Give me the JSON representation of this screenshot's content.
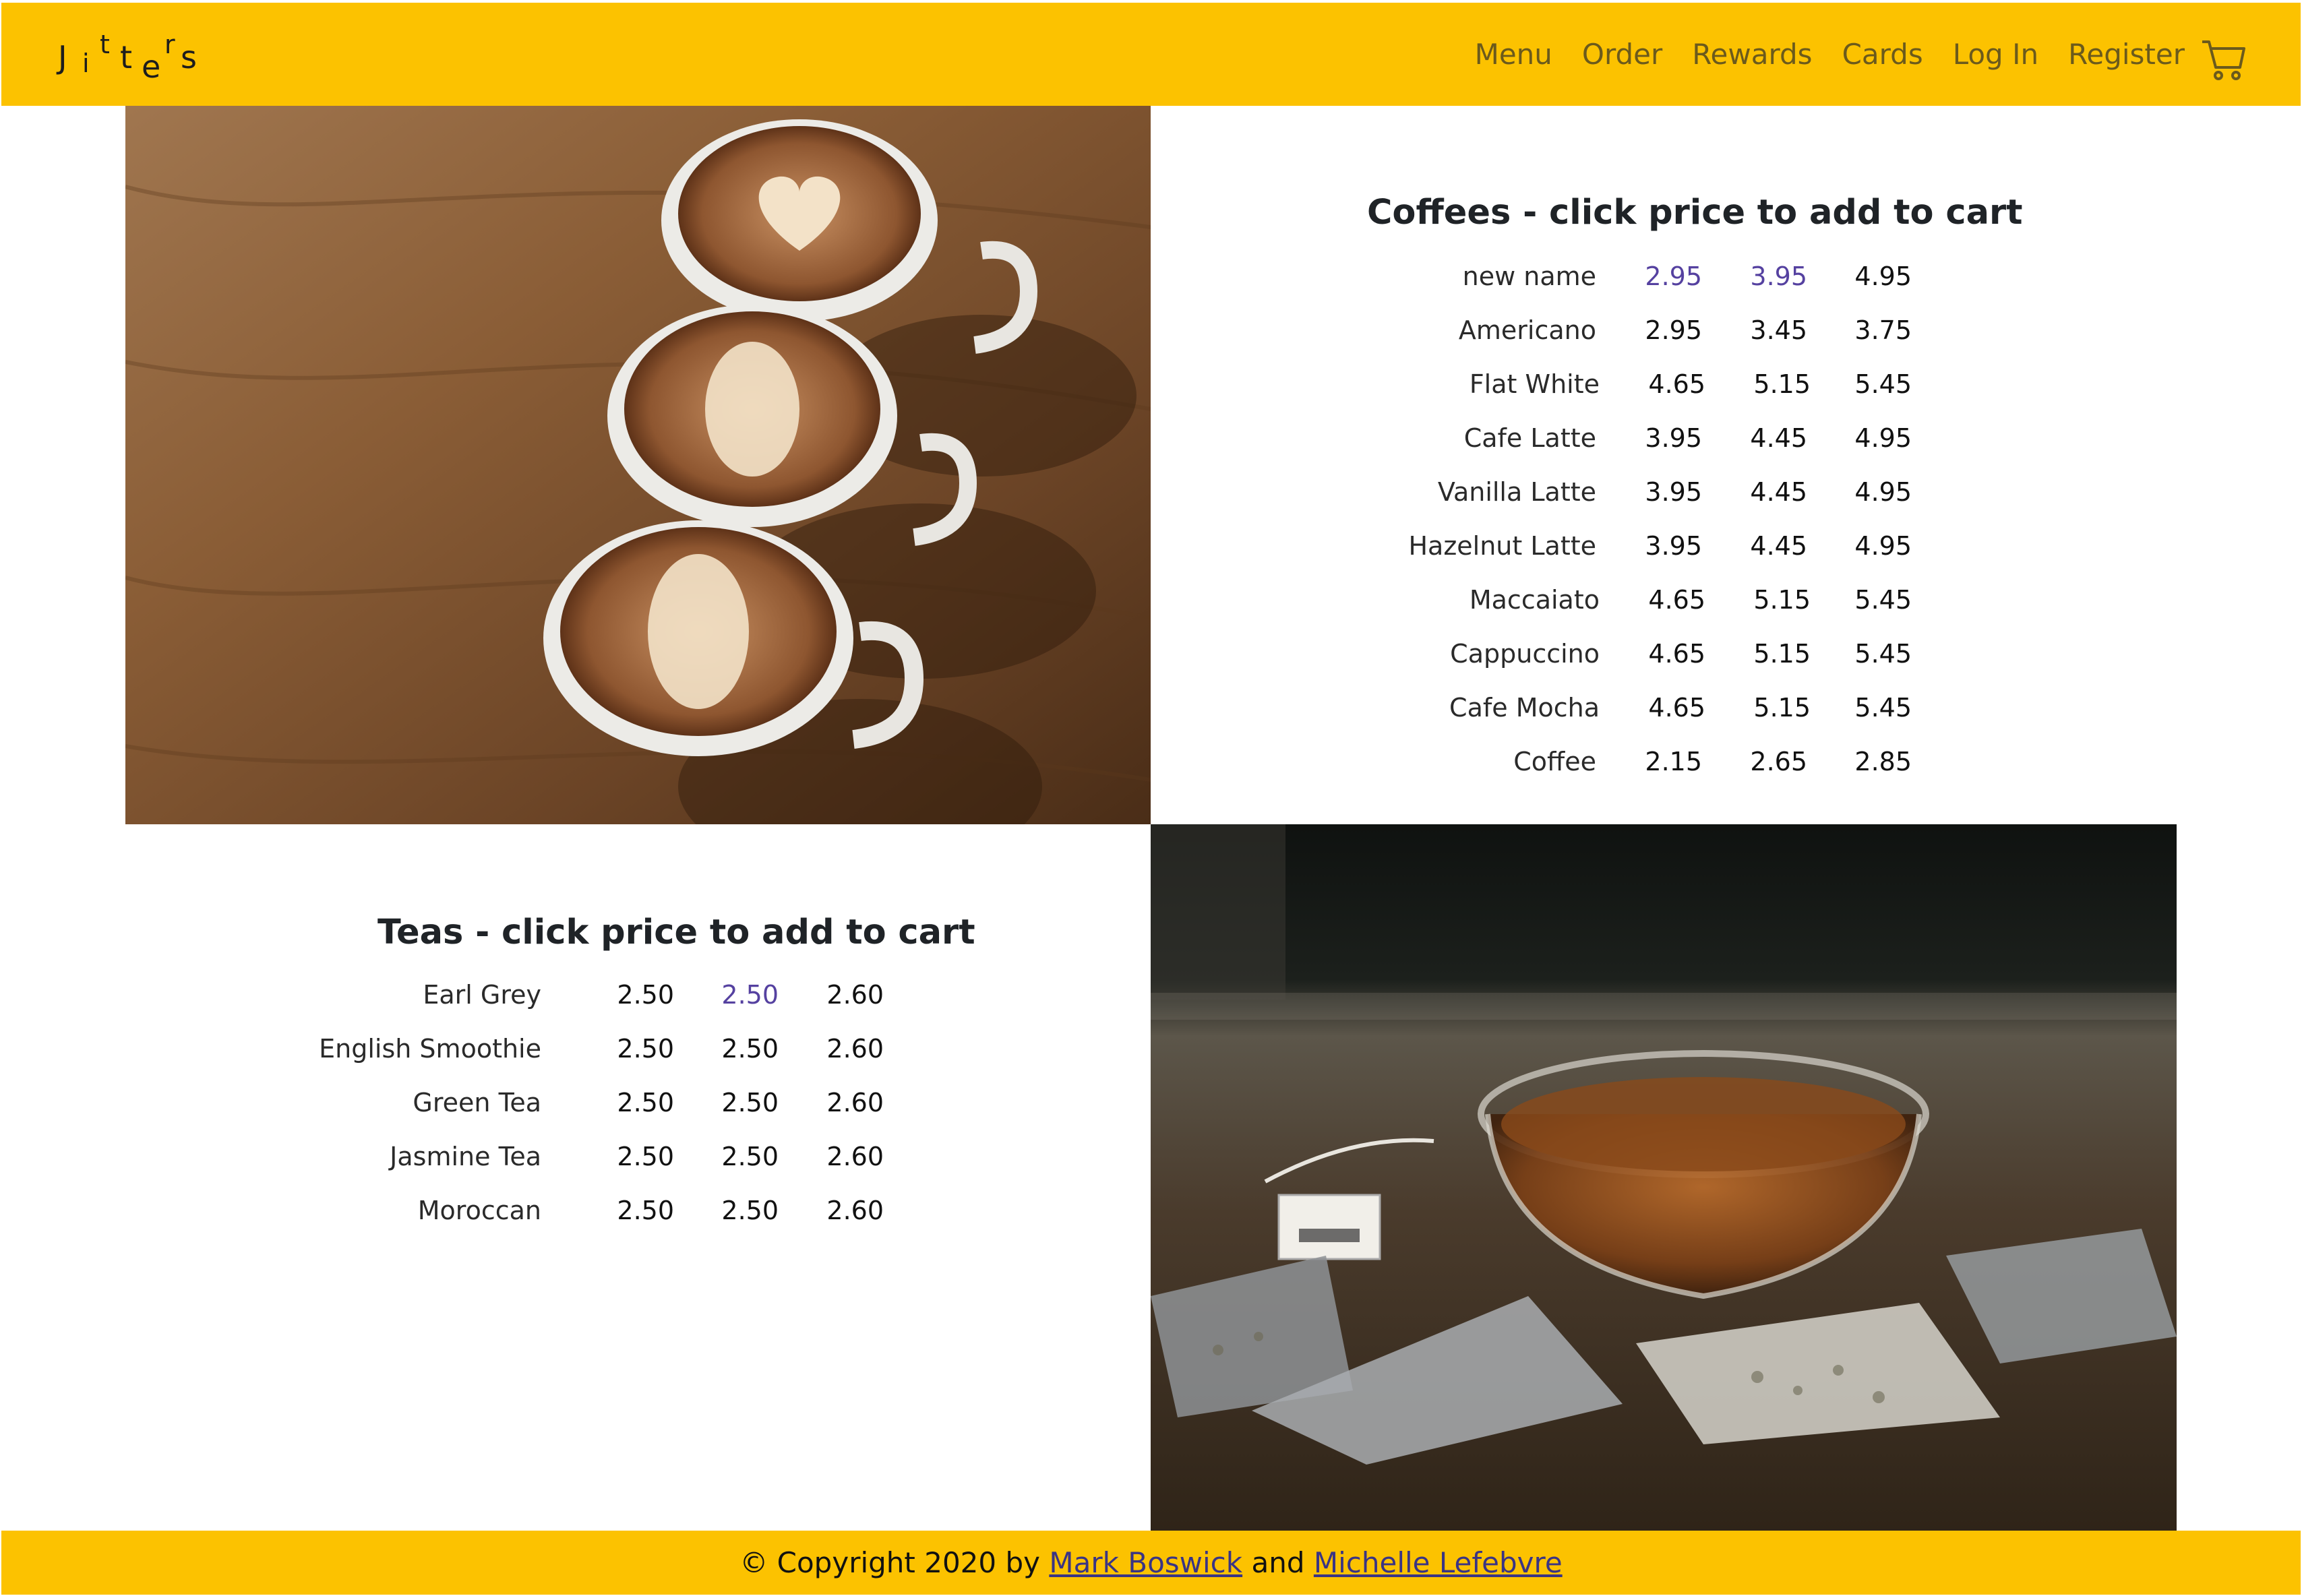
{
  "brand": {
    "letters": [
      "J",
      "i",
      "t",
      "t",
      "e",
      "r",
      "s"
    ]
  },
  "nav": {
    "items": [
      "Menu",
      "Order",
      "Rewards",
      "Cards",
      "Log In",
      "Register"
    ],
    "cart_icon": "shopping-cart-icon"
  },
  "coffees": {
    "title": "Coffees - click price to add to cart",
    "rows": [
      {
        "name": "new name",
        "prices": [
          "2.95",
          "3.95",
          "4.95"
        ]
      },
      {
        "name": "Americano",
        "prices": [
          "2.95",
          "3.45",
          "3.75"
        ]
      },
      {
        "name": "Flat White",
        "prices": [
          "4.65",
          "5.15",
          "5.45"
        ]
      },
      {
        "name": "Cafe Latte",
        "prices": [
          "3.95",
          "4.45",
          "4.95"
        ]
      },
      {
        "name": "Vanilla Latte",
        "prices": [
          "3.95",
          "4.45",
          "4.95"
        ]
      },
      {
        "name": "Hazelnut Latte",
        "prices": [
          "3.95",
          "4.45",
          "4.95"
        ]
      },
      {
        "name": "Maccaiato",
        "prices": [
          "4.65",
          "5.15",
          "5.45"
        ]
      },
      {
        "name": "Cappuccino",
        "prices": [
          "4.65",
          "5.15",
          "5.45"
        ]
      },
      {
        "name": "Cafe Mocha",
        "prices": [
          "4.65",
          "5.15",
          "5.45"
        ]
      },
      {
        "name": "Coffee",
        "prices": [
          "2.15",
          "2.65",
          "2.85"
        ]
      }
    ]
  },
  "teas": {
    "title": "Teas - click price to add to cart",
    "rows": [
      {
        "name": "Earl Grey",
        "prices": [
          "2.50",
          "2.50",
          "2.60"
        ]
      },
      {
        "name": "English Smoothie",
        "prices": [
          "2.50",
          "2.50",
          "2.60"
        ]
      },
      {
        "name": "Green Tea",
        "prices": [
          "2.50",
          "2.50",
          "2.60"
        ]
      },
      {
        "name": "Jasmine Tea",
        "prices": [
          "2.50",
          "2.50",
          "2.60"
        ]
      },
      {
        "name": "Moroccan",
        "prices": [
          "2.50",
          "2.50",
          "2.60"
        ]
      }
    ]
  },
  "footer": {
    "prefix": "© Copyright 2020 by",
    "author1": "Mark Boswick",
    "conj": "and",
    "author2": "Michelle Lefebvre"
  },
  "colors": {
    "accent": "#fcc200",
    "visited_price": "#5541a0",
    "link": "#3a3484"
  }
}
